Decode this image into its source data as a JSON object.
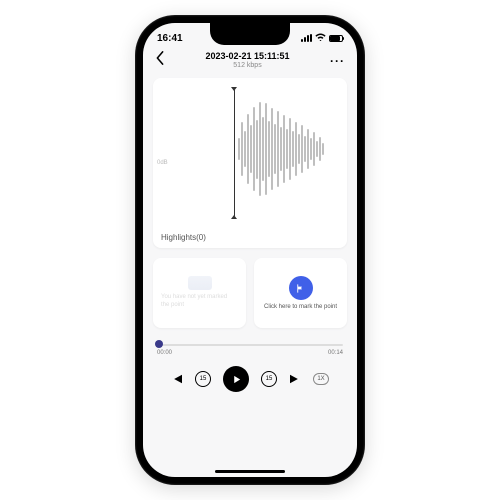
{
  "status": {
    "time": "16:41"
  },
  "header": {
    "title": "2023-02-21 15:11:51",
    "subtitle": "512 kbps"
  },
  "waveform": {
    "axis_label": "0dB",
    "highlights_label": "Highlights(0)"
  },
  "cards": {
    "empty_hint_line1": "You have not yet marked",
    "empty_hint_line2": "the point",
    "mark_label": "Click here to mark the point"
  },
  "timeline": {
    "current": "00:00",
    "total": "00:14"
  },
  "controls": {
    "back15": "15",
    "fwd15": "15",
    "speed": "1X"
  }
}
